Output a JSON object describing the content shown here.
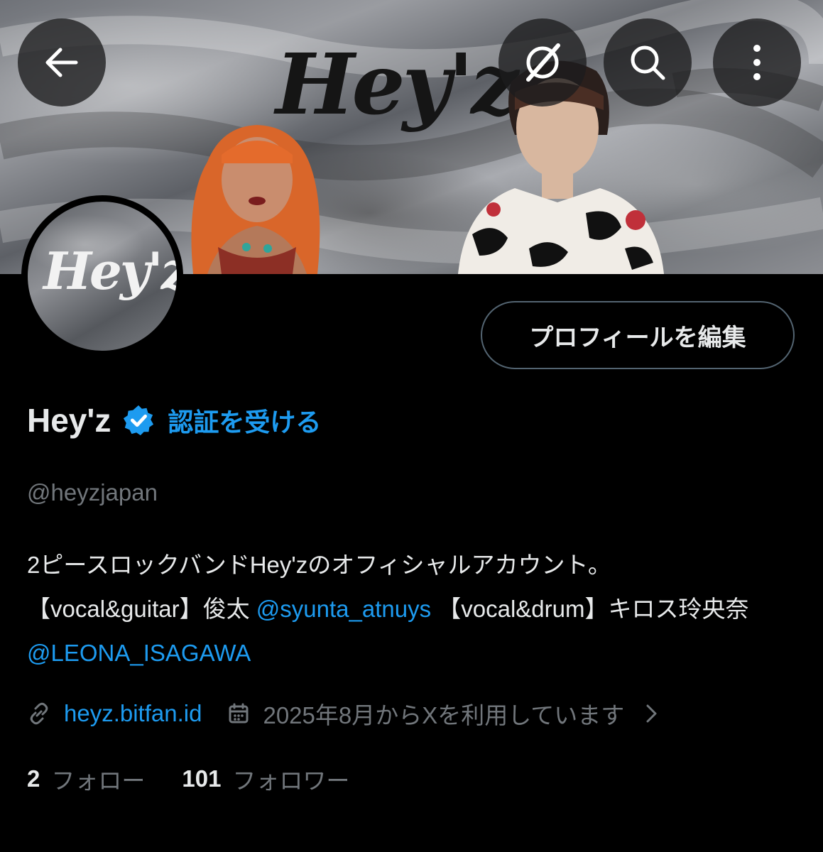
{
  "banner": {
    "logo_text": "Hey'z"
  },
  "nav": {
    "back_icon": "arrow-left-icon",
    "grok_icon": "grok-icon",
    "search_icon": "search-icon",
    "more_icon": "more-vertical-icon"
  },
  "avatar": {
    "logo_text": "Hey'z"
  },
  "profile": {
    "edit_label": "プロフィールを編集",
    "display_name": "Hey'z",
    "verified_icon": "verified-badge-icon",
    "get_verified_label": "認証を受ける",
    "handle": "@heyzjapan",
    "bio": {
      "line1": "2ピースロックバンドHey'zのオフィシャルアカウント。",
      "part_guitar_prefix": "【vocal&guitar】俊太 ",
      "mention_1": "@syunta_atnuys",
      "part_drum_prefix": " 【vocal&drum】キロス玲央奈 ",
      "mention_2": "@LEONA_ISAGAWA"
    },
    "website": "heyz.bitfan.id",
    "joined": "2025年8月からXを利用しています"
  },
  "stats": {
    "following_count": "2",
    "following_label": "フォロー",
    "followers_count": "101",
    "followers_label": "フォロワー"
  },
  "colors": {
    "background": "#000000",
    "text_primary": "#e7e9ea",
    "text_secondary": "#71767b",
    "accent": "#1d9bf0",
    "border": "#536471"
  }
}
